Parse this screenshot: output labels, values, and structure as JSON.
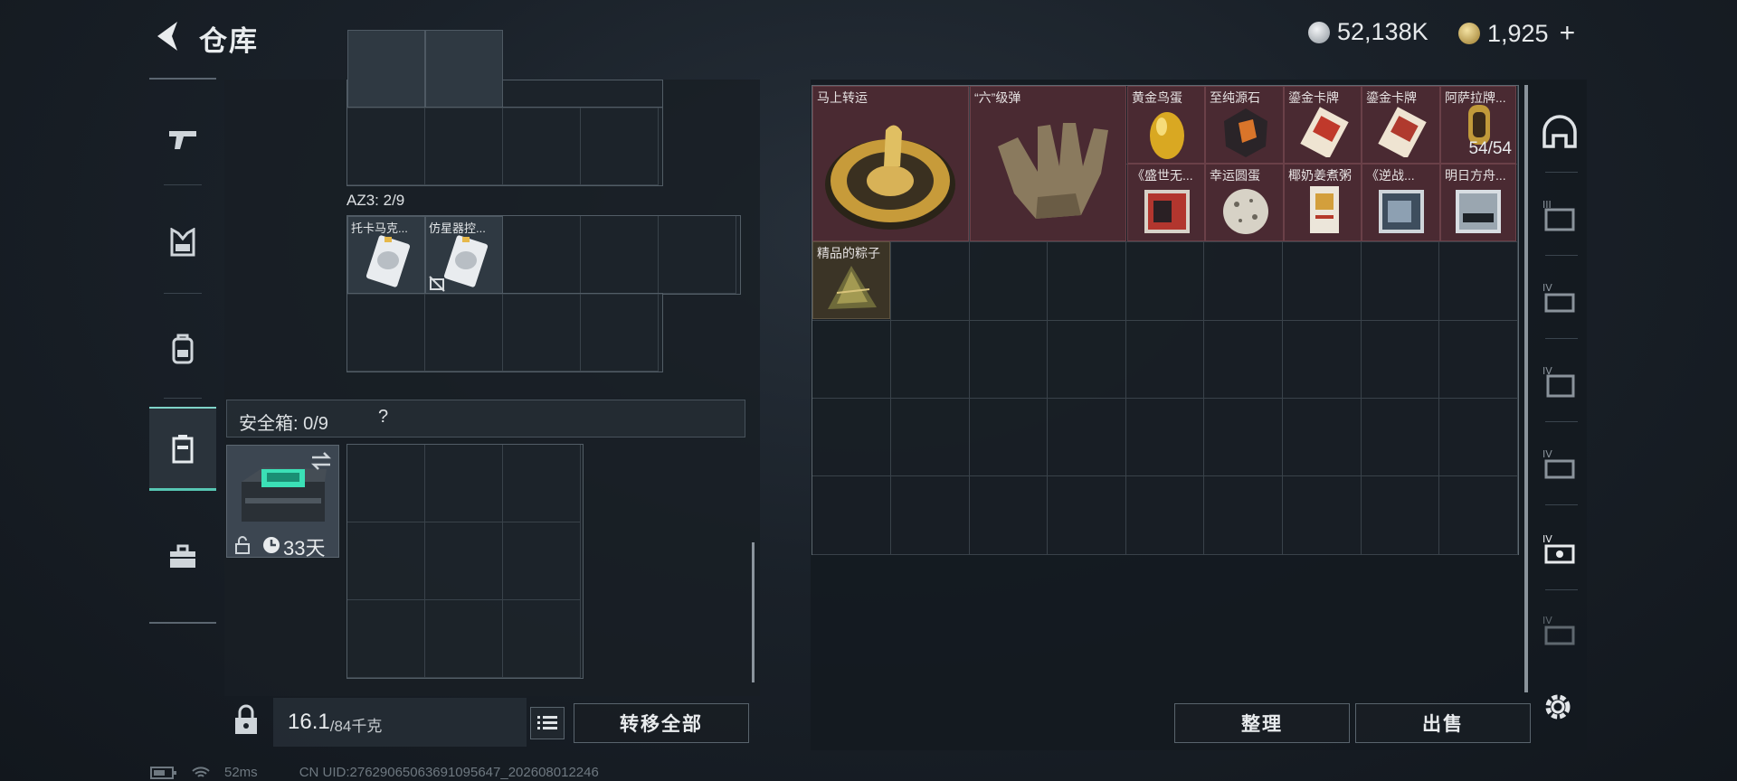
{
  "header": {
    "title": "仓库",
    "currency_silver": "52,138K",
    "currency_gold": "1,925",
    "plus_label": "+"
  },
  "left_nav": {
    "items": [
      {
        "name": "weapons",
        "icon": "gun-icon"
      },
      {
        "name": "armor",
        "icon": "armor-vest-icon"
      },
      {
        "name": "backpack",
        "icon": "backpack-icon"
      },
      {
        "name": "safe-box",
        "icon": "safebox-icon",
        "selected": true
      },
      {
        "name": "toolbox",
        "icon": "briefcase-icon"
      }
    ]
  },
  "container_az3": {
    "label": "AZ3: 2/9",
    "items": [
      {
        "name": "托卡马克..."
      },
      {
        "name": "仿星器控..."
      }
    ]
  },
  "safe_box": {
    "label": "安全箱: 0/9",
    "help": "?",
    "days": "33天"
  },
  "weight": {
    "current": "16.1",
    "max": "/84千克"
  },
  "buttons": {
    "transfer_all": "转移全部",
    "organize": "整理",
    "sell": "出售"
  },
  "stash_items": [
    {
      "name": "马上转运"
    },
    {
      "name": "“六”级弹"
    },
    {
      "name": "黄金鸟蛋"
    },
    {
      "name": "至纯源石"
    },
    {
      "name": "鎏金卡牌"
    },
    {
      "name": "鎏金卡牌"
    },
    {
      "name": "阿萨拉牌..."
    },
    {
      "name": "《盛世无..."
    },
    {
      "name": "幸运圆蛋"
    },
    {
      "name": "椰奶姜煮粥"
    },
    {
      "name": "《逆战..."
    },
    {
      "name": "明日方舟..."
    },
    {
      "name": "精品的粽子"
    }
  ],
  "stack_count": "54/54",
  "status": {
    "ping": "52ms",
    "uid": "CN UID:27629065063691095647_202608012246"
  },
  "colors": {
    "accent": "#57c7b3",
    "rare_item_bg": "#4a2a32",
    "panel_bg": "#1a2129"
  }
}
